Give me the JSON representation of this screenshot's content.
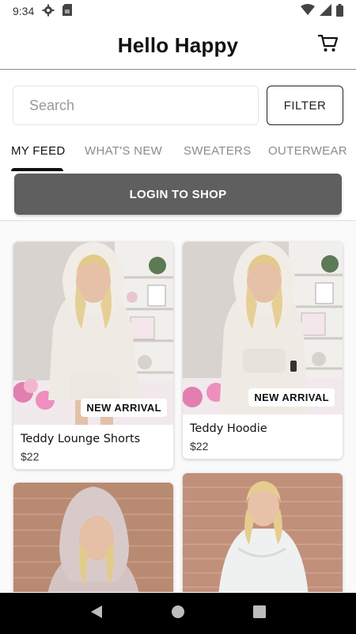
{
  "status_bar": {
    "time": "9:34"
  },
  "header": {
    "title": "Hello Happy"
  },
  "search": {
    "placeholder": "Search",
    "filter_label": "FILTER"
  },
  "tabs": [
    {
      "label": "MY FEED",
      "active": true
    },
    {
      "label": "WHAT'S NEW",
      "active": false
    },
    {
      "label": "SWEATERS",
      "active": false
    },
    {
      "label": "OUTERWEAR",
      "active": false
    }
  ],
  "login_button": {
    "label": "LOGIN TO SHOP"
  },
  "products": [
    {
      "name": "Teddy Lounge Shorts",
      "price": "$22",
      "badge": "NEW ARRIVAL"
    },
    {
      "name": "Teddy Hoodie",
      "price": "$22",
      "badge": "NEW ARRIVAL"
    },
    {
      "name": "",
      "price": "",
      "badge": ""
    },
    {
      "name": "",
      "price": "",
      "badge": ""
    }
  ],
  "colors": {
    "login_bg": "#5f5f5f",
    "accent": "#111111",
    "nav_bar": "#000000"
  },
  "icons": [
    "gear-icon",
    "sim-card-icon",
    "wifi-icon",
    "signal-icon",
    "battery-icon",
    "cart-icon",
    "back-icon",
    "home-icon",
    "recents-icon"
  ]
}
